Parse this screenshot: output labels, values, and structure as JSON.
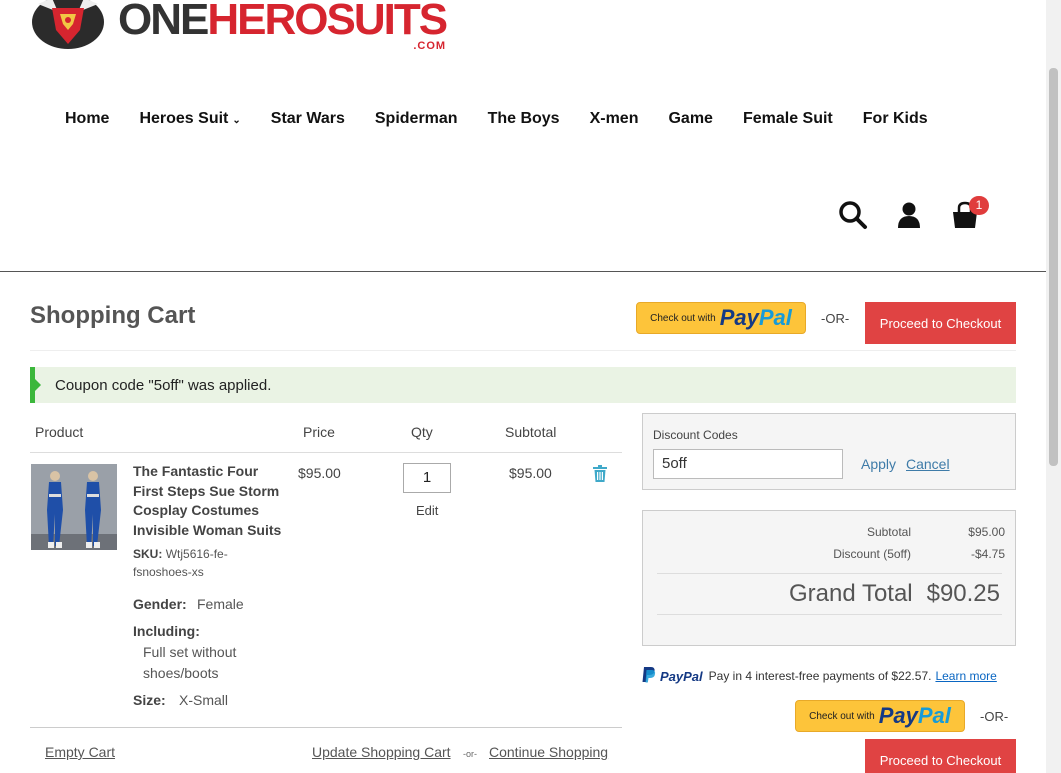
{
  "logo": {
    "one": "ONE",
    "hero": "HEROSUITS",
    "com": ".COM"
  },
  "nav": {
    "items": [
      "Home",
      "Heroes Suit",
      "Star Wars",
      "Spiderman",
      "The Boys",
      "X-men",
      "Game",
      "Female Suit",
      "For Kids"
    ]
  },
  "header": {
    "cart_count": "1"
  },
  "cart": {
    "title": "Shopping Cart",
    "or_label": "-OR-",
    "checkout_label": "Proceed to Checkout",
    "paypal_small": "Check out with",
    "paypal_pay": "Pay",
    "paypal_pal": "Pal"
  },
  "message": "Coupon code \"5off\" was applied.",
  "table": {
    "headers": {
      "product": "Product",
      "price": "Price",
      "qty": "Qty",
      "subtotal": "Subtotal"
    },
    "item": {
      "name": "The Fantastic Four First Steps Sue Storm Cosplay Costumes Invisible Woman Suits",
      "sku_label": "SKU:",
      "sku": "Wtj5616-fe-fsnoshoes-xs",
      "gender_label": "Gender:",
      "gender": "Female",
      "including_label": "Including:",
      "including": "Full set without shoes/boots",
      "size_label": "Size:",
      "size": "X-Small",
      "price": "$95.00",
      "qty": "1",
      "edit": "Edit",
      "subtotal": "$95.00"
    },
    "empty_cart": "Empty Cart",
    "update_cart": "Update Shopping Cart",
    "or_small": "-or-",
    "continue": "Continue Shopping"
  },
  "discount": {
    "label": "Discount Codes",
    "value": "5off",
    "apply": "Apply",
    "cancel": "Cancel"
  },
  "totals": {
    "subtotal_label": "Subtotal",
    "subtotal": "$95.00",
    "discount_label": "Discount (5off)",
    "discount": "-$4.75",
    "grand_label": "Grand Total",
    "grand": "$90.25"
  },
  "paylater": {
    "brand": "PayPal",
    "text": "Pay in 4 interest-free payments of $22.57.",
    "link": "Learn more"
  },
  "colors": {
    "accent_red": "#e04343",
    "paypal_yellow": "#fdc43a",
    "success_green": "#3bb73b",
    "link_blue": "#3e7ba8"
  }
}
